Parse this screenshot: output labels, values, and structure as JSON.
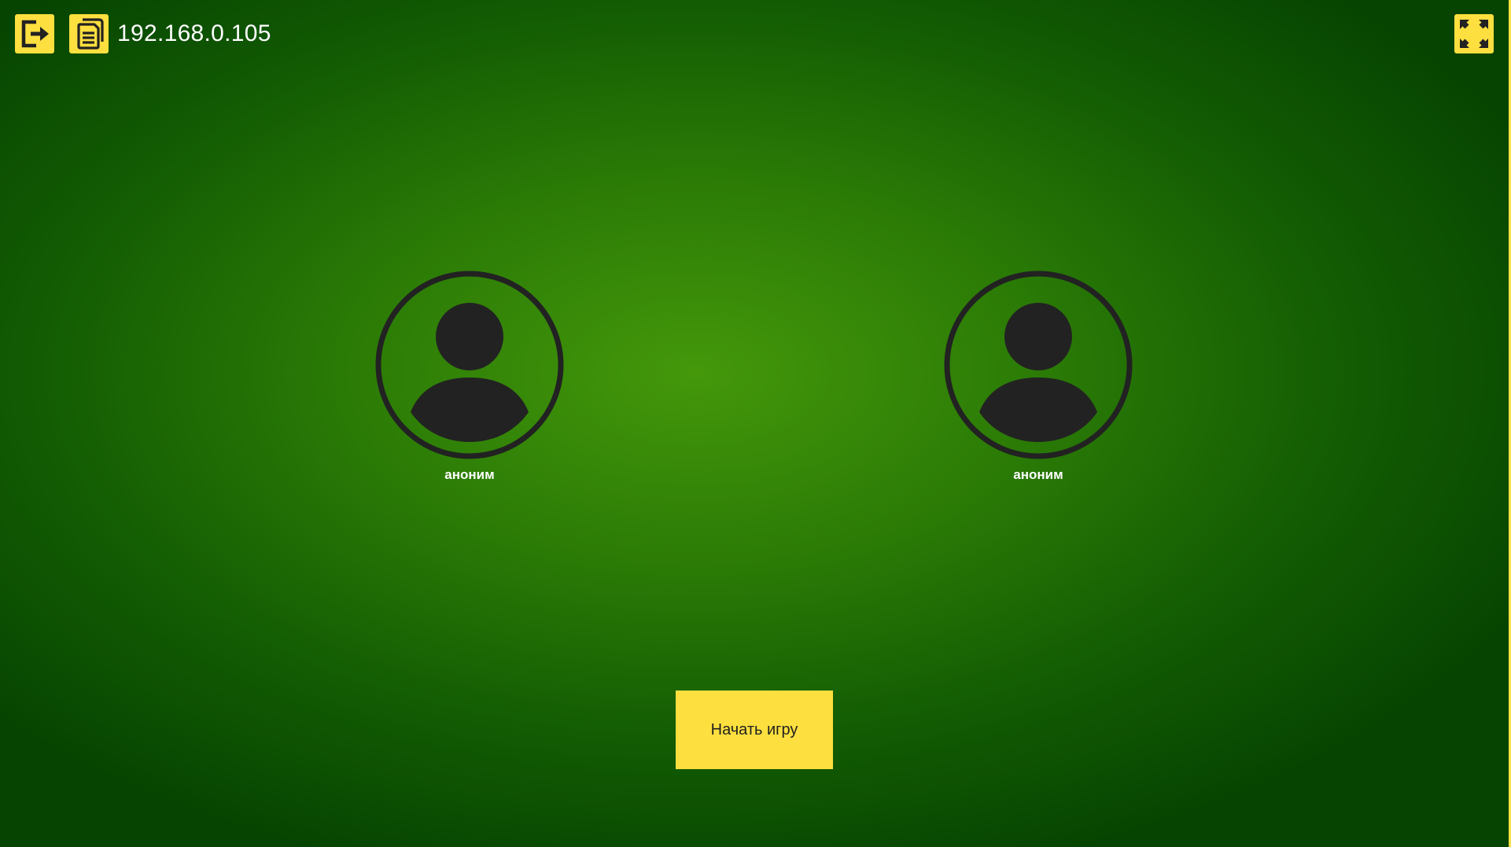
{
  "header": {
    "exit_icon": "exit-icon",
    "log_icon": "document-icon",
    "server_address": "192.168.0.105",
    "fullscreen_icon": "fullscreen-icon"
  },
  "players": [
    {
      "name": "аноним",
      "avatar_icon": "user-avatar-icon"
    },
    {
      "name": "аноним",
      "avatar_icon": "user-avatar-icon"
    }
  ],
  "actions": {
    "start_game_label": "Начать игру"
  },
  "colors": {
    "accent": "#fddf3f",
    "icon_dark": "#222222",
    "background_center": "#44980a",
    "background_edge": "#064401"
  }
}
